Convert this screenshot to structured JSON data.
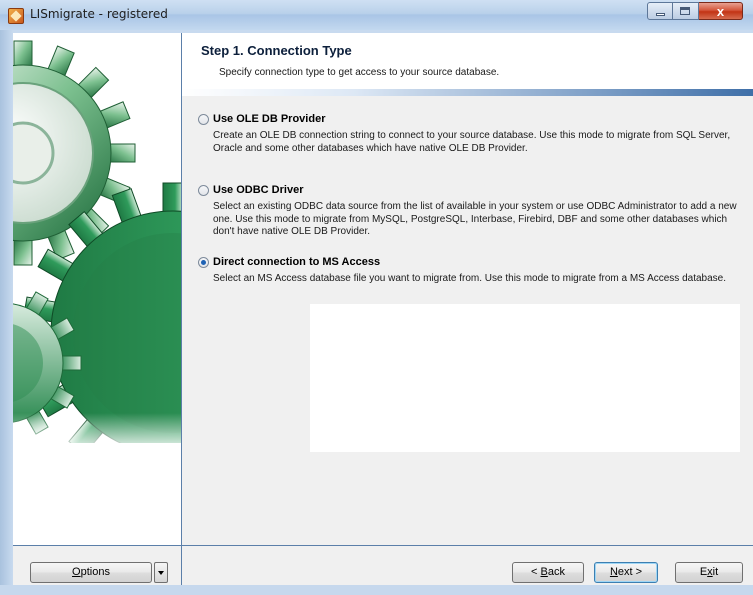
{
  "window": {
    "title": "LISmigrate - registered",
    "close_glyph": "x"
  },
  "header": {
    "title": "Step 1. Connection Type",
    "subtitle": "Specify connection type to get access to your source database."
  },
  "options": [
    {
      "label": "Use OLE DB Provider",
      "selected": false,
      "description": "Create an OLE DB connection string to connect to your source database. Use this mode to migrate from SQL Server, Oracle and some other databases which have native OLE DB Provider."
    },
    {
      "label": "Use ODBC Driver",
      "selected": false,
      "description": "Select an existing ODBC data source from the list of available in your system or use ODBC Administrator to add a new one. Use this mode to migrate from MySQL, PostgreSQL, Interbase, Firebird, DBF and some other databases which don't have native OLE DB Provider."
    },
    {
      "label": "Direct connection to MS Access",
      "selected": true,
      "description": "Select an MS Access database file you want to migrate from. Use this mode to migrate from a MS Access database."
    }
  ],
  "footer": {
    "options_label": {
      "pre": "",
      "key": "O",
      "post": "ptions"
    },
    "back_label": {
      "pre": "< ",
      "key": "B",
      "post": "ack"
    },
    "next_label": {
      "pre": "",
      "key": "N",
      "post": "ext >"
    },
    "exit_label": {
      "pre": "E",
      "key": "x",
      "post": "it"
    }
  },
  "colors": {
    "accent": "#3f6fa8",
    "gear_green": "#2e9a5a",
    "panel_border": "#5b7fa9"
  },
  "icons": [
    "app-icon",
    "minimize-icon",
    "maximize-icon",
    "close-icon",
    "gear-illustration",
    "dropdown-arrow-icon"
  ]
}
